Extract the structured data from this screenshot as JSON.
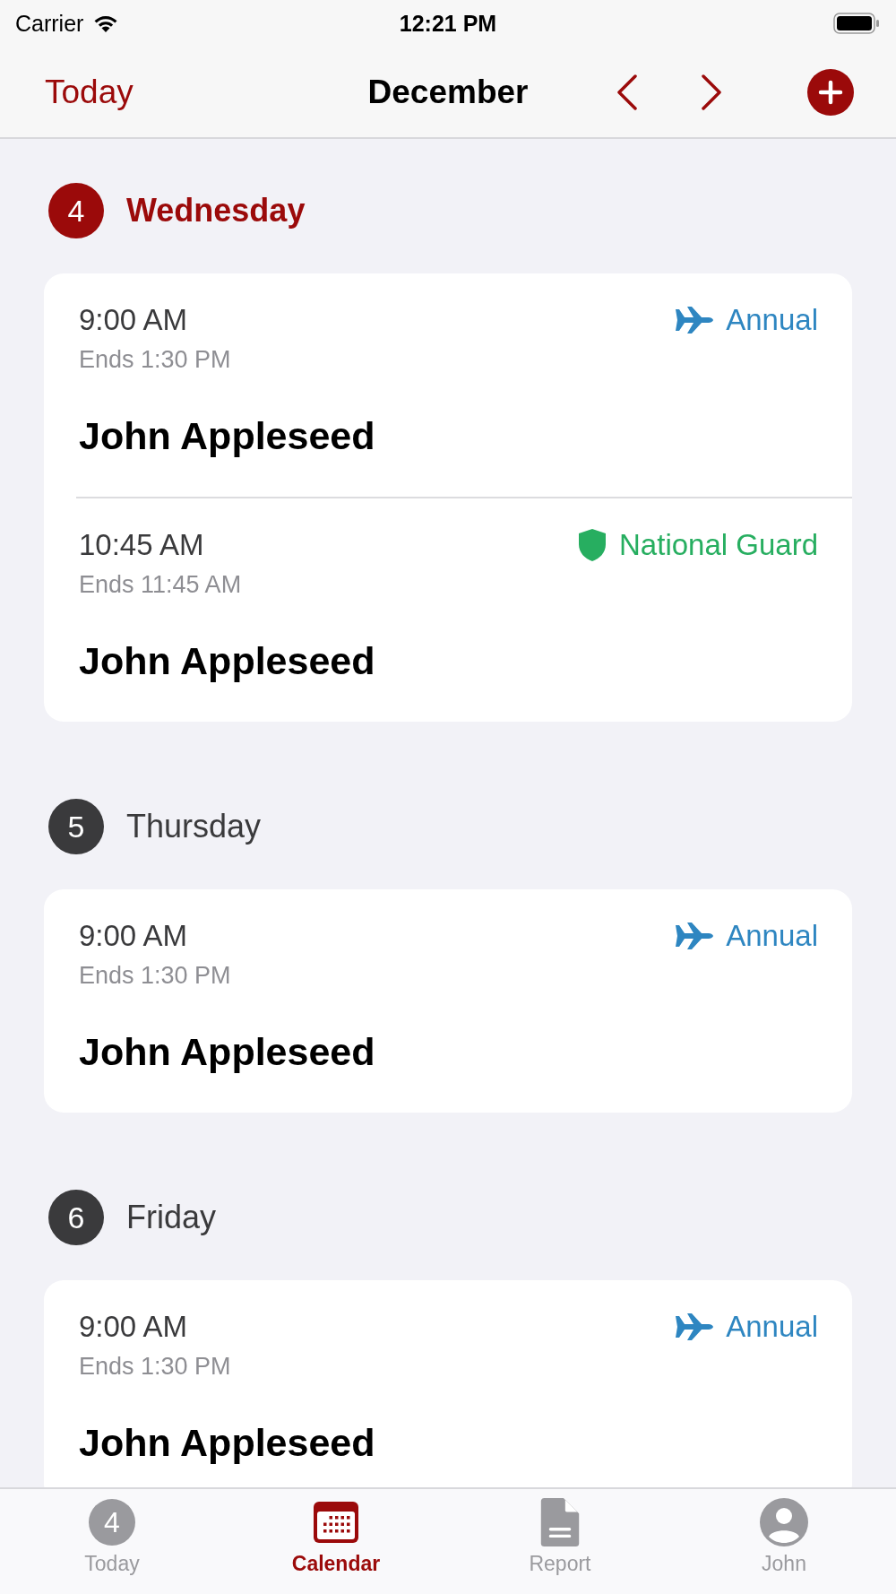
{
  "status_bar": {
    "carrier": "Carrier",
    "time": "12:21 PM"
  },
  "nav_bar": {
    "today_button": "Today",
    "title": "December"
  },
  "days": [
    {
      "number": "4",
      "name": "Wednesday",
      "today": true,
      "events": [
        {
          "time": "9:00 AM",
          "ends": "Ends 1:30 PM",
          "name": "John Appleseed",
          "category": {
            "kind": "annual",
            "label": "Annual",
            "color": "#2e86c1"
          }
        },
        {
          "time": "10:45 AM",
          "ends": "Ends 11:45 AM",
          "name": "John Appleseed",
          "category": {
            "kind": "national_guard",
            "label": "National Guard",
            "color": "#27ae60"
          }
        }
      ]
    },
    {
      "number": "5",
      "name": "Thursday",
      "today": false,
      "events": [
        {
          "time": "9:00 AM",
          "ends": "Ends 1:30 PM",
          "name": "John Appleseed",
          "category": {
            "kind": "annual",
            "label": "Annual",
            "color": "#2e86c1"
          }
        }
      ]
    },
    {
      "number": "6",
      "name": "Friday",
      "today": false,
      "events": [
        {
          "time": "9:00 AM",
          "ends": "Ends 1:30 PM",
          "name": "John Appleseed",
          "category": {
            "kind": "annual",
            "label": "Annual",
            "color": "#2e86c1"
          }
        }
      ]
    }
  ],
  "tab_bar": [
    {
      "kind": "badge",
      "badge": "4",
      "label": "Today",
      "selected": false
    },
    {
      "kind": "calendar",
      "label": "Calendar",
      "selected": true
    },
    {
      "kind": "document",
      "label": "Report",
      "selected": false
    },
    {
      "kind": "person",
      "label": "John",
      "selected": false
    }
  ]
}
